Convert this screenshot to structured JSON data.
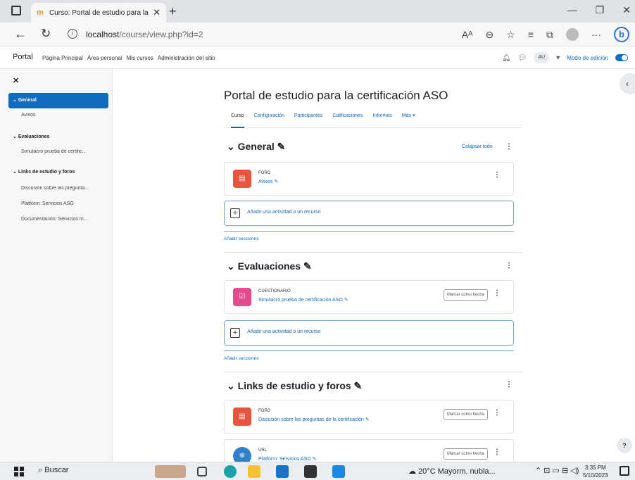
{
  "browser": {
    "tab_title": "Curso: Portal de estudio para la c",
    "url_host": "localhost",
    "url_path": "/course/view.php?id=2",
    "reader_label": "Aᴬ"
  },
  "navbar": {
    "brand": "Portal",
    "links": [
      "Página Principal",
      "Área personal",
      "Mis cursos",
      "Administración del sitio"
    ],
    "avatar_initials": "AU",
    "edit_mode_label": "Modo de edición"
  },
  "drawer": {
    "sections": [
      {
        "title": "General",
        "items": [
          "Avisos"
        ]
      },
      {
        "title": "Evaluaciones",
        "items": [
          "Simulacro prueba de certific..."
        ]
      },
      {
        "title": "Links de estudio y foros",
        "items": [
          "Discusión sobre las pregunta...",
          "Platform: Servicios ASO",
          "Documentación: Servicios m..."
        ]
      }
    ]
  },
  "course": {
    "title": "Portal de estudio para la certificación ASO",
    "tabs": [
      "Curso",
      "Configuración",
      "Participantes",
      "Calificaciones",
      "Informes",
      "Más ▾"
    ],
    "collapse_all": "Colapsar todo",
    "add_activity": "Añadir una actividad o un recurso",
    "add_sections": "Añadir secciones",
    "mark_done": "Marcar como hecha",
    "sections": [
      {
        "title": "General",
        "activities": [
          {
            "type": "FORO",
            "name": "Avisos"
          }
        ]
      },
      {
        "title": "Evaluaciones",
        "activities": [
          {
            "type": "CUESTIONARIO",
            "name": "Simulacro prueba de certificación ASO"
          }
        ]
      },
      {
        "title": "Links de estudio y foros",
        "activities": [
          {
            "type": "FORO",
            "name": "Discusión sobre las preguntas de la certificación"
          },
          {
            "type": "URL",
            "name": "Platform: Servicios ASO"
          }
        ]
      }
    ]
  },
  "taskbar": {
    "search_label": "Buscar",
    "weather": "20°C  Mayorm. nubla...",
    "time": "3:35 PM",
    "date": "5/10/2023"
  },
  "colors": {
    "accent": "#0f6cbf",
    "forum_icon": "#e8553f",
    "quiz_icon": "#e44b8d",
    "url_icon": "#2f80c8"
  }
}
